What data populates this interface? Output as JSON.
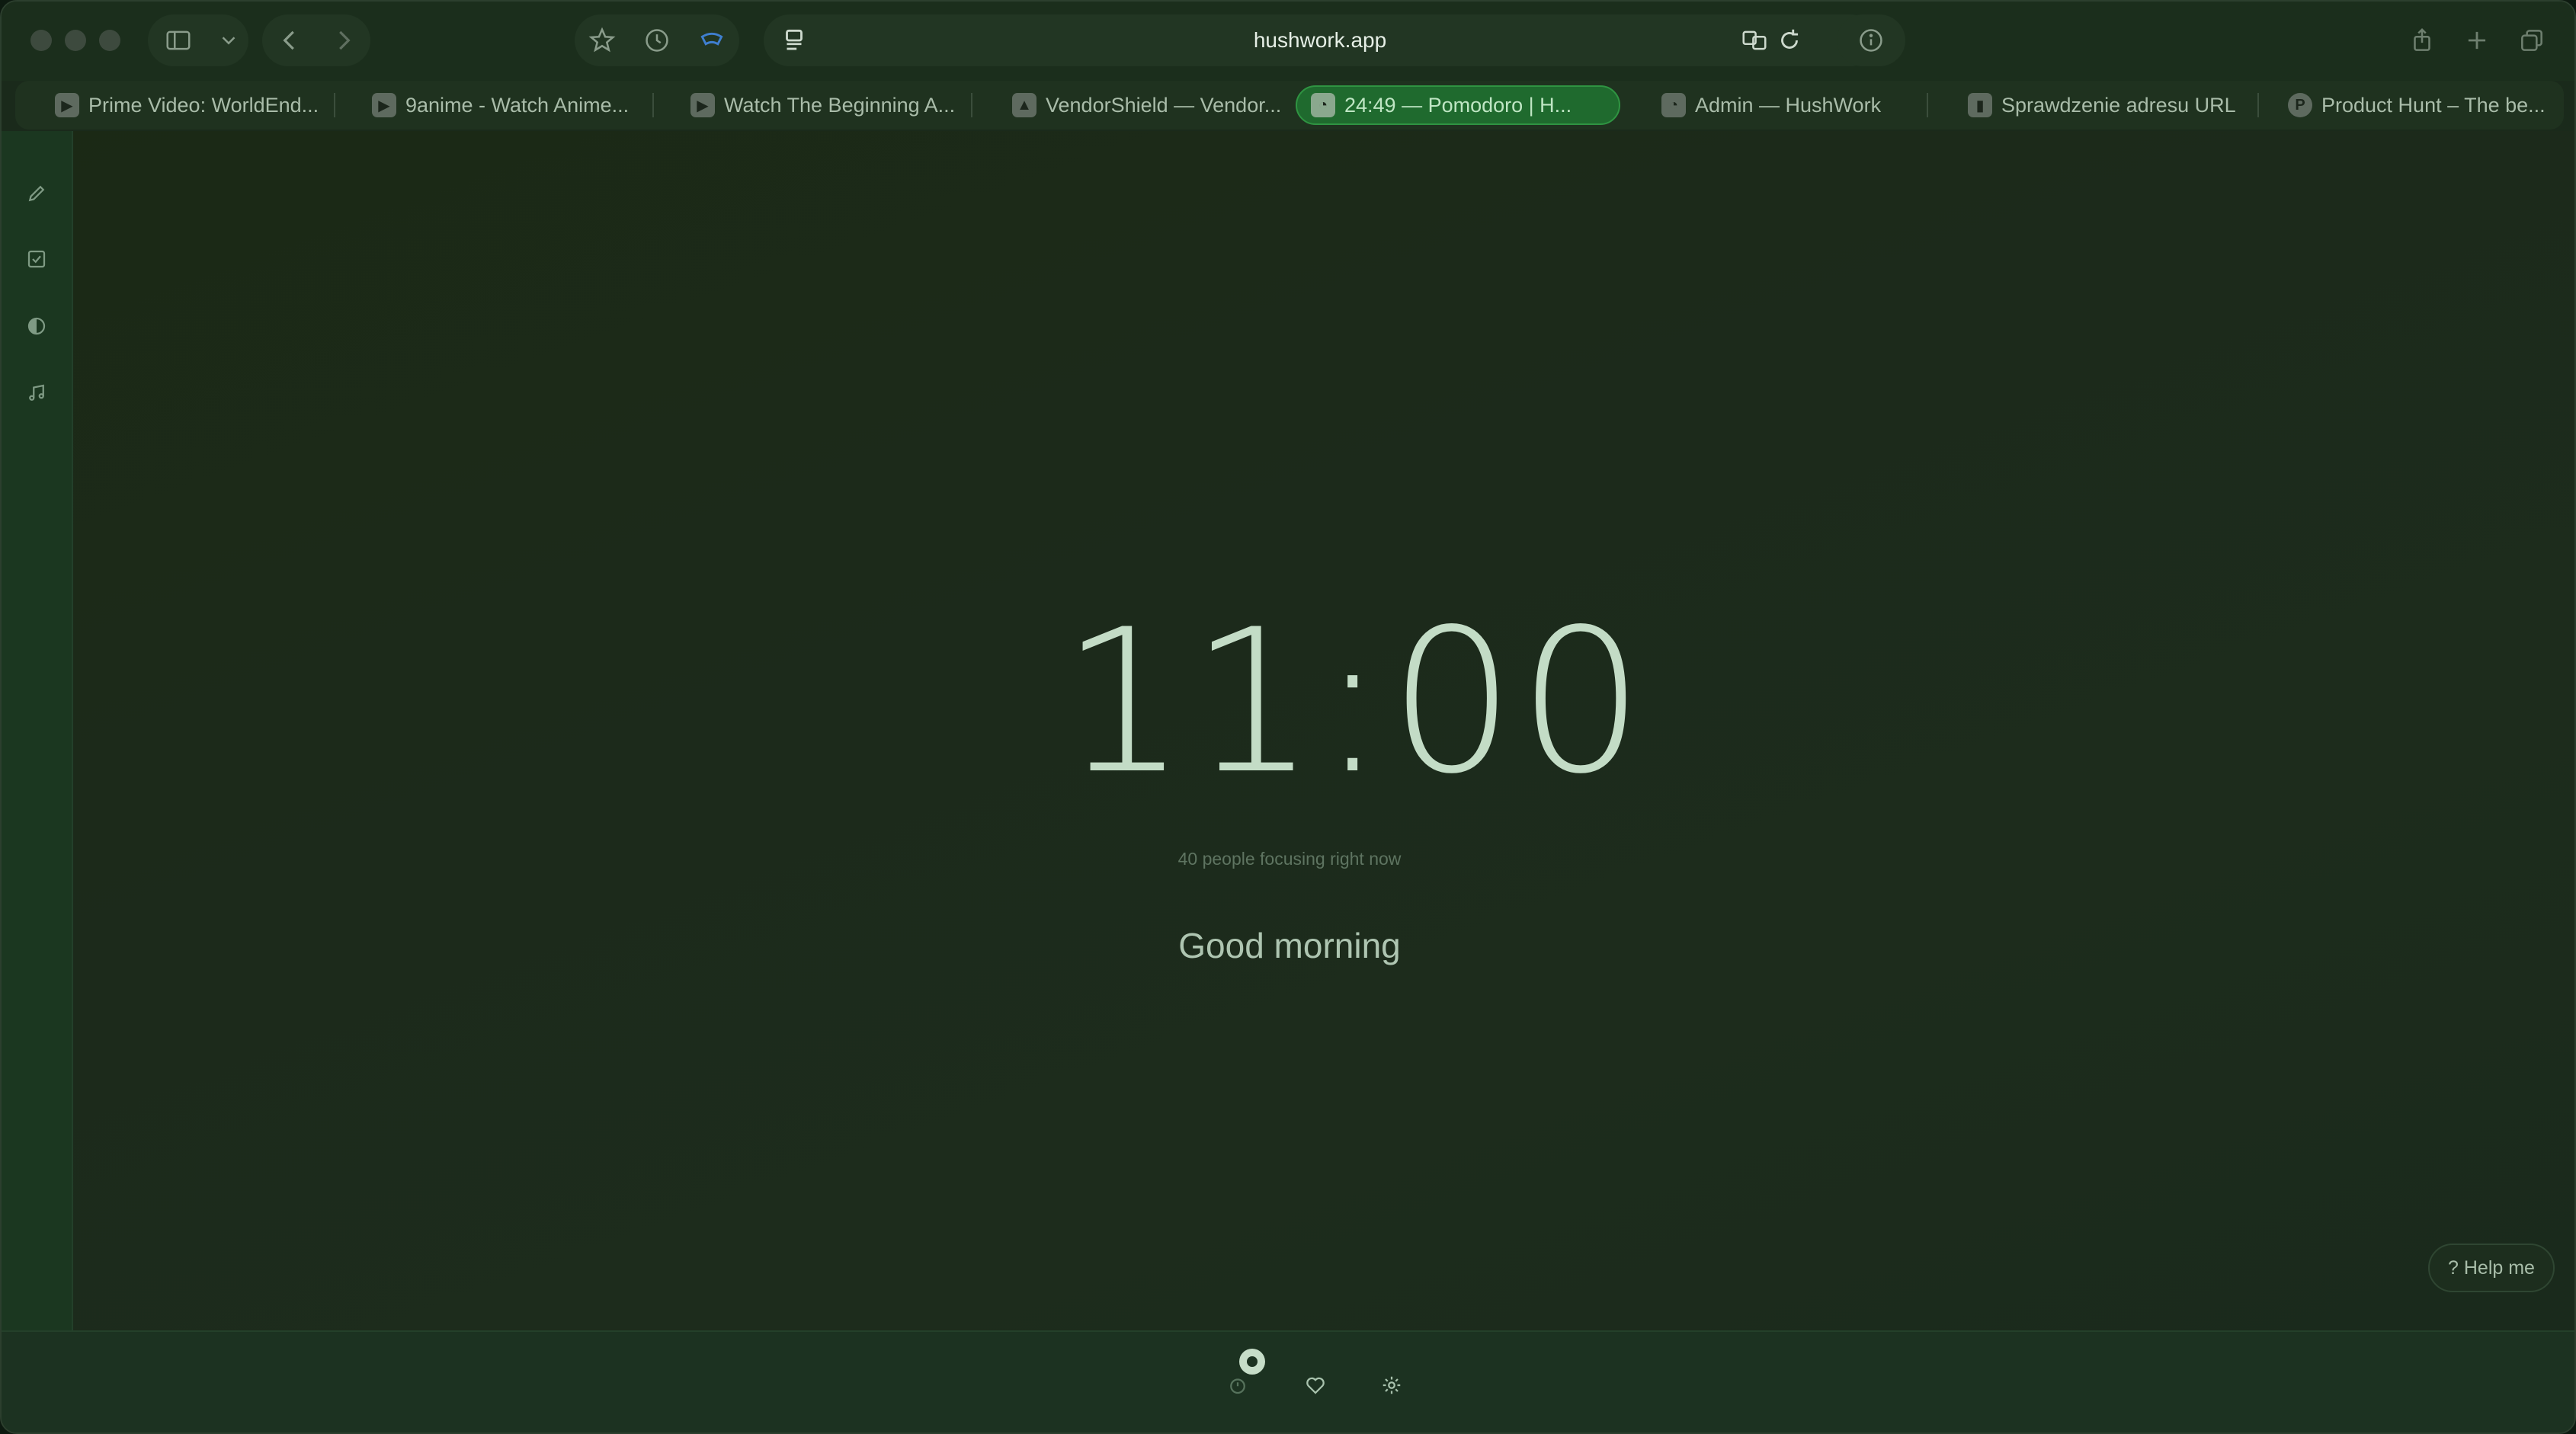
{
  "browser": {
    "url": "hushwork.app",
    "tabs": [
      {
        "label": "Prime Video: WorldEnd...",
        "favicon": "prime-video"
      },
      {
        "label": "9anime - Watch Anime...",
        "favicon": "play"
      },
      {
        "label": "Watch The Beginning A...",
        "favicon": "play"
      },
      {
        "label": "VendorShield — Vendor...",
        "favicon": "vendorshield"
      },
      {
        "label": "24:49 — Pomodoro | H...",
        "favicon": "hushwork",
        "active": true
      },
      {
        "label": "Admin — HushWork",
        "favicon": "hushwork"
      },
      {
        "label": "Sprawdzenie adresu URL",
        "favicon": "bars"
      },
      {
        "label": "Product Hunt – The be...",
        "favicon": "P"
      }
    ]
  },
  "app": {
    "clock": "11:00",
    "focusing_text": "40 people focusing right now",
    "greeting": "Good morning",
    "help_label": "? Help me",
    "sidebar_icons": [
      "pencil-icon",
      "checkbox-icon",
      "contrast-icon",
      "music-note-icon"
    ],
    "bottom_icons": [
      "timer-icon",
      "heart-icon",
      "gear-icon"
    ]
  },
  "colors": {
    "background": "#1c2a1b",
    "accent": "#2f9442",
    "text": "#c3dcc6"
  }
}
